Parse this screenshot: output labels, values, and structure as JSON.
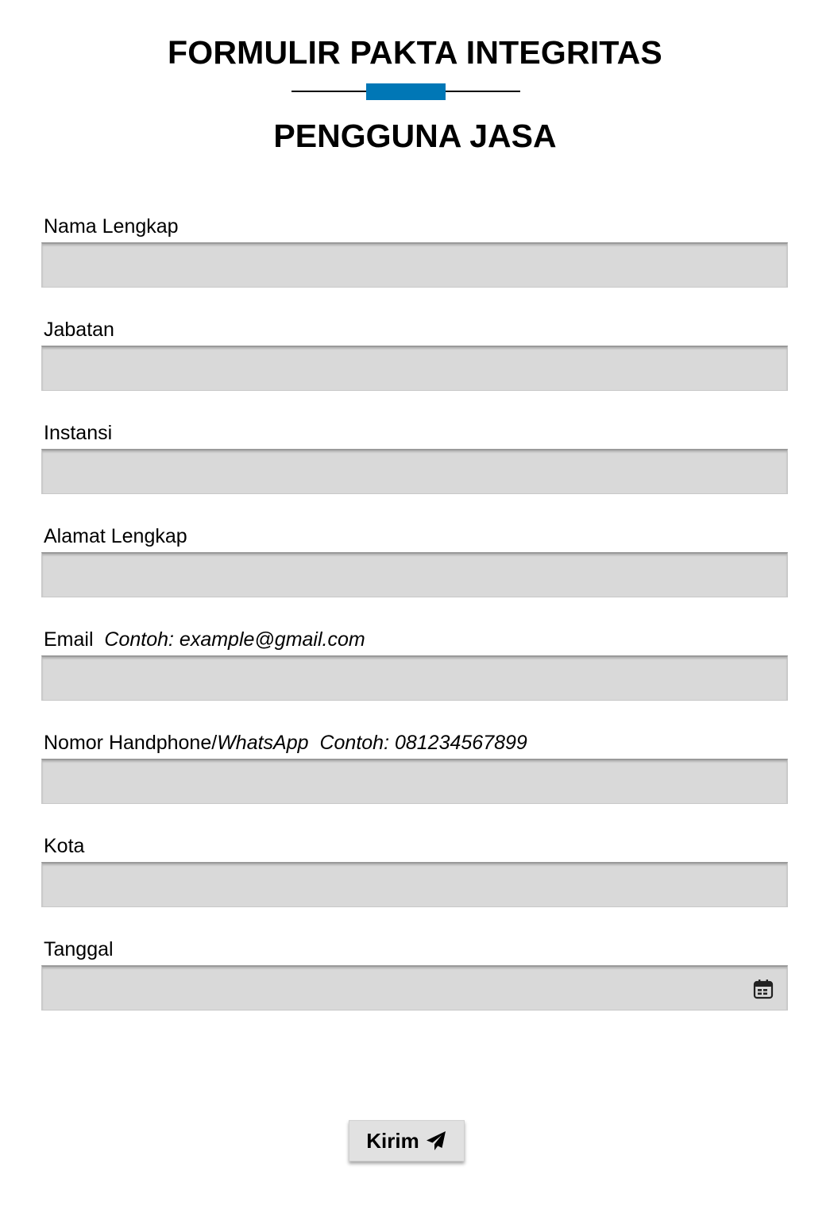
{
  "header": {
    "title": "FORMULIR PAKTA INTEGRITAS",
    "subtitle": "PENGGUNA JASA",
    "accent_color": "#0077b6"
  },
  "form": {
    "fields": [
      {
        "label": "Nama Lengkap",
        "value": ""
      },
      {
        "label": "Jabatan",
        "value": ""
      },
      {
        "label": "Instansi",
        "value": ""
      },
      {
        "label": "Alamat Lengkap",
        "value": ""
      },
      {
        "label": "Email",
        "hint": "Contoh: example@gmail.com",
        "value": ""
      },
      {
        "label": "Nomor Handphone/",
        "label_italic": "WhatsApp",
        "hint": "Contoh: 081234567899",
        "value": ""
      },
      {
        "label": "Kota",
        "value": ""
      },
      {
        "label": "Tanggal",
        "value": "",
        "icon": "calendar-icon"
      }
    ],
    "input_bg": "#d9d9d9"
  },
  "submit": {
    "label": "Kirim",
    "icon": "paper-plane-icon"
  }
}
